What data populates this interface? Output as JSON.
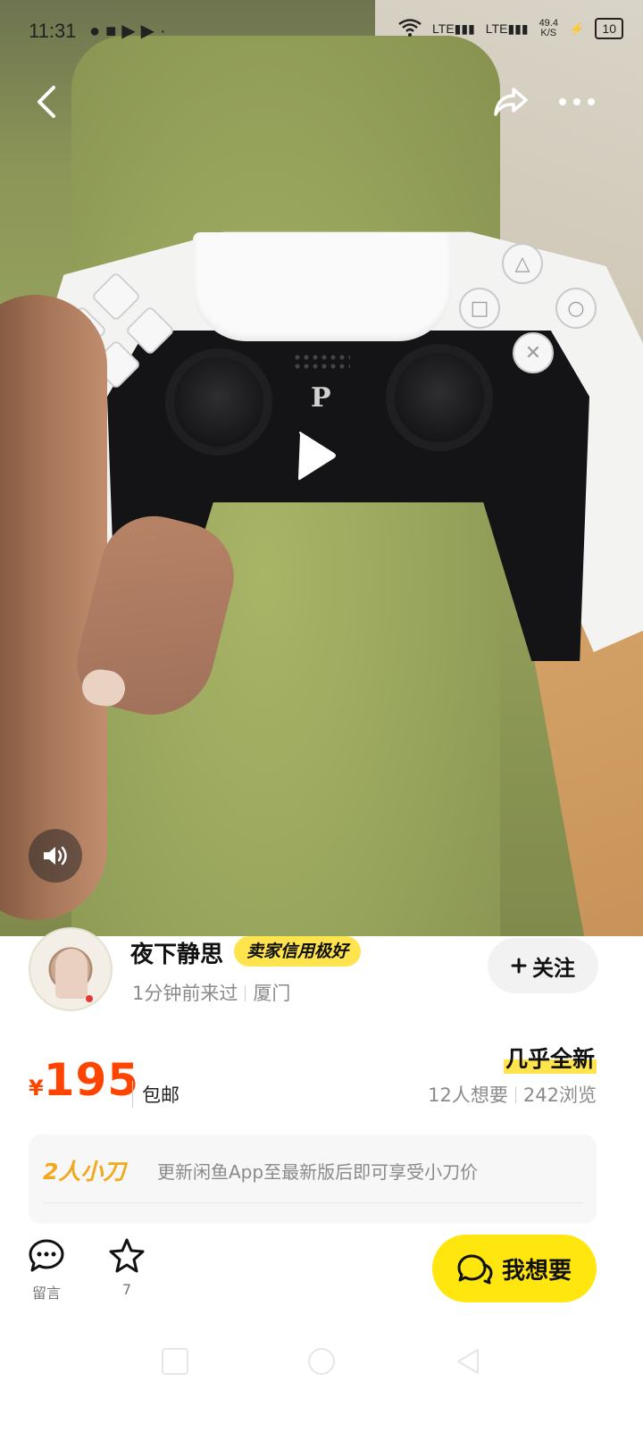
{
  "status_bar": {
    "time": "11:31",
    "network_speed": "49.4",
    "network_speed_unit": "K/S",
    "battery": "10",
    "signal_labels": [
      "LTE",
      "LTE"
    ]
  },
  "media": {
    "play_icon": "play-icon",
    "mute_icon": "speaker-icon"
  },
  "seller": {
    "name": "夜下静思",
    "badge": "卖家信用极好",
    "last_seen": "1分钟前来过",
    "location": "厦门",
    "follow_label": "关注"
  },
  "listing": {
    "currency": "¥",
    "price": "195",
    "shipping": "包邮",
    "condition": "几乎全新",
    "wants": "12人想要",
    "views": "242浏览"
  },
  "bargain": {
    "title": "2人小刀",
    "description": "更新闲鱼App至最新版后即可享受小刀价"
  },
  "actions": {
    "comment_label": "留言",
    "favorite_count": "7",
    "want_label": "我想要"
  },
  "colors": {
    "accent_yellow": "#ffe60f",
    "price_orange": "#ff4400",
    "bargain_gold": "#f2a81c"
  }
}
